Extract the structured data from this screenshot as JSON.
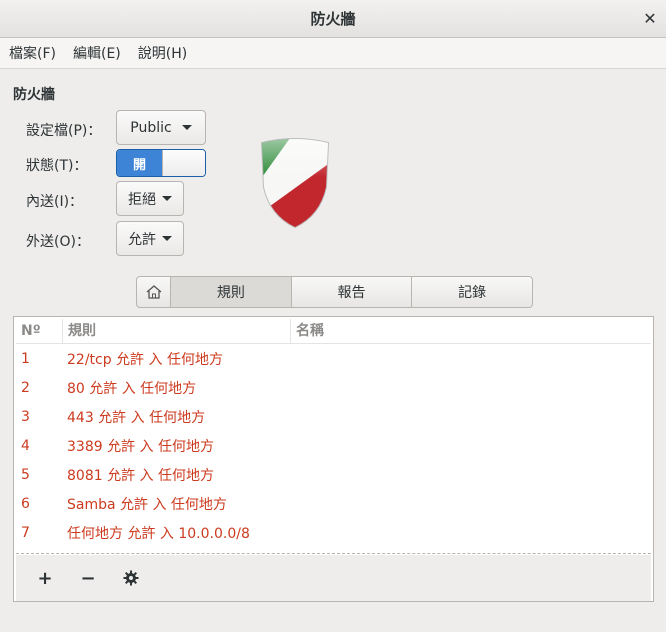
{
  "window": {
    "title": "防火牆"
  },
  "menubar": {
    "items": [
      "檔案(F)",
      "編輯(E)",
      "說明(H)"
    ]
  },
  "section": {
    "title": "防火牆"
  },
  "form": {
    "profile_label": "設定檔(P)：",
    "profile_value": "Public",
    "status_label": "狀態(T)：",
    "status_value": "開",
    "incoming_label": "內送(I)：",
    "incoming_value": "拒絕",
    "outgoing_label": "外送(O)：",
    "outgoing_value": "允許"
  },
  "tabs": {
    "items": [
      "規則",
      "報告",
      "記錄"
    ],
    "active": 0
  },
  "table": {
    "columns": [
      "Nº",
      "規則",
      "名稱"
    ],
    "rows": [
      {
        "n": "1",
        "rule": "22/tcp 允許 入 任何地方",
        "name": ""
      },
      {
        "n": "2",
        "rule": "80 允許 入 任何地方",
        "name": ""
      },
      {
        "n": "3",
        "rule": "443 允許 入 任何地方",
        "name": ""
      },
      {
        "n": "4",
        "rule": "3389 允許 入 任何地方",
        "name": ""
      },
      {
        "n": "5",
        "rule": "8081 允許 入 任何地方",
        "name": ""
      },
      {
        "n": "6",
        "rule": "Samba 允許 入 任何地方",
        "name": ""
      },
      {
        "n": "7",
        "rule": "任何地方 允許 入 10.0.0.0/8",
        "name": ""
      }
    ]
  },
  "toolbar": {
    "add": "+",
    "remove": "−",
    "settings_icon": "gear-icon"
  },
  "colors": {
    "rule_text": "#cc3b1f",
    "switch_on": "#3d84d6"
  }
}
